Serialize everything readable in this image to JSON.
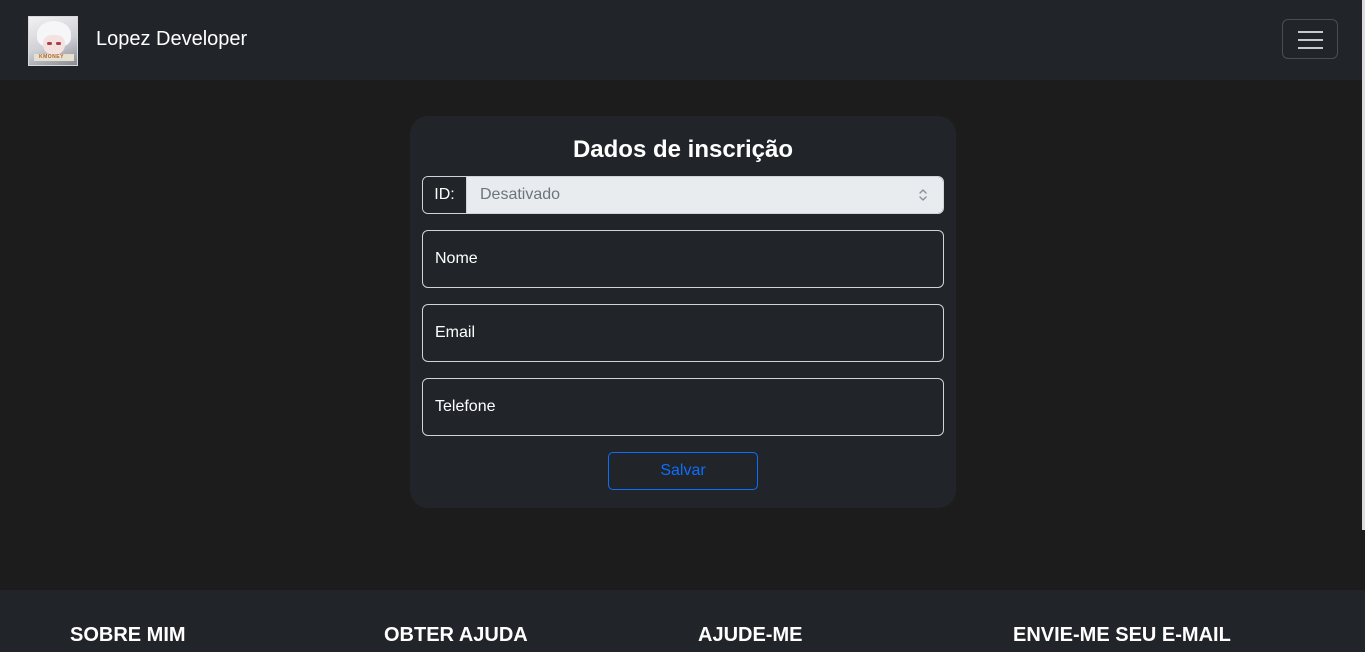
{
  "navbar": {
    "brand": "Lopez Developer",
    "avatar_text": "KMONEY"
  },
  "form": {
    "title": "Dados de inscrição",
    "id_label": "ID:",
    "id_value": "Desativado",
    "name_placeholder": "Nome",
    "email_placeholder": "Email",
    "phone_placeholder": "Telefone",
    "save_label": "Salvar"
  },
  "footer": {
    "sections": [
      "SOBRE MIM",
      "OBTER AJUDA",
      "AJUDE-ME",
      "ENVIE-ME SEU E-MAIL"
    ]
  },
  "colors": {
    "page_bg": "#1c1c1d",
    "surface": "#212429",
    "accent": "#0d6efd",
    "disabled_bg": "#e9ecef"
  }
}
